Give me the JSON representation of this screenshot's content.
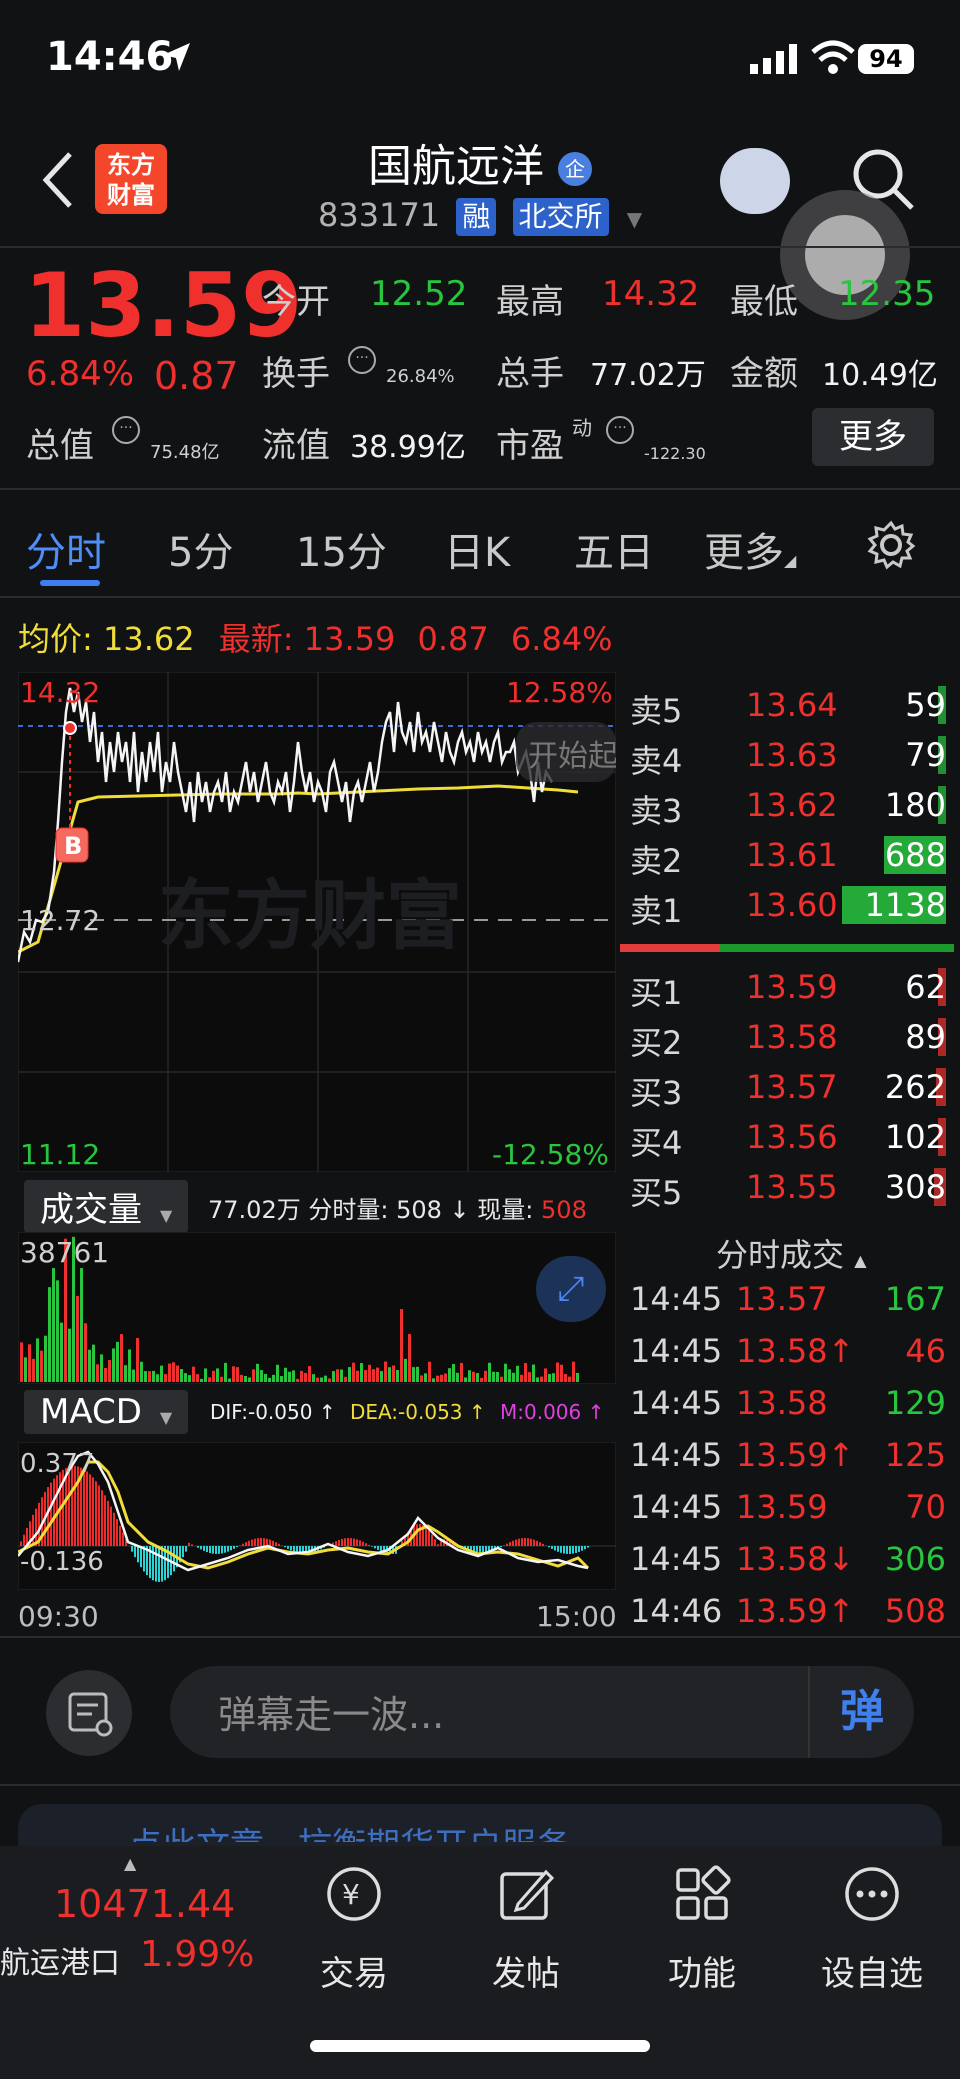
{
  "status_bar": {
    "time": "14:46",
    "battery": "94"
  },
  "header": {
    "title": "国航远洋",
    "code": "833171",
    "tag_rong": "融",
    "tag_exchange": "北交所",
    "logo_line1": "东方",
    "logo_line2": "财富"
  },
  "quote": {
    "price": "13.59",
    "change_pct": "6.84%",
    "change": "0.87",
    "open_label": "今开",
    "open": "12.52",
    "high_label": "最高",
    "high": "14.32",
    "low_label": "最低",
    "low": "12.35",
    "turnover_label": "换手",
    "turnover": "26.84%",
    "volume_label": "总手",
    "volume": "77.02万",
    "amount_label": "金额",
    "amount": "10.49亿",
    "mktcap_label": "总值",
    "mktcap": "75.48亿",
    "float_label": "流值",
    "float_cap": "38.99亿",
    "pe_label": "市盈",
    "pe_sup": "动",
    "pe": "-122.30",
    "more": "更多"
  },
  "tabs": [
    "分时",
    "5分",
    "15分",
    "日K",
    "五日",
    "更多"
  ],
  "info_line": {
    "avg_label": "均价:",
    "avg": "13.62",
    "latest_label": "最新:",
    "latest": "13.59",
    "latest_change": "0.87",
    "latest_pct": "6.84%"
  },
  "chart_labels": {
    "price_high": "14.32",
    "pct_high": "12.58%",
    "price_mid": "12.72",
    "price_low": "11.12",
    "pct_low": "-12.58%",
    "start_hint": "开始起",
    "watermark": "东方财富",
    "buy_marker": "B",
    "time_start": "09:30",
    "time_end": "15:00"
  },
  "volume_panel": {
    "selector": "成交量",
    "total": "77.02万",
    "minute_label": "分时量:",
    "minute": "508",
    "now_label": "现量:",
    "now": "508",
    "max_label": "38761"
  },
  "macd_panel": {
    "selector": "MACD",
    "dif": "DIF:-0.050 ↑",
    "dea": "DEA:-0.053 ↑",
    "m": "M:0.006 ↑",
    "top_label": "0.377",
    "bottom_label": "-0.136"
  },
  "order_book": {
    "sell": [
      {
        "label": "卖5",
        "price": "13.64",
        "vol": "59",
        "bar": 0.02,
        "color": "#28c63f"
      },
      {
        "label": "卖4",
        "price": "13.63",
        "vol": "79",
        "bar": 0.03,
        "color": "#28c63f"
      },
      {
        "label": "卖3",
        "price": "13.62",
        "vol": "180",
        "bar": 0.06,
        "color": "#28c63f"
      },
      {
        "label": "卖2",
        "price": "13.61",
        "vol": "688",
        "bar": 0.6,
        "color": "#28c63f"
      },
      {
        "label": "卖1",
        "price": "13.60",
        "vol": "1138",
        "bar": 1.0,
        "color": "#28c63f"
      }
    ],
    "buy": [
      {
        "label": "买1",
        "price": "13.59",
        "vol": "62",
        "bar": 0.02,
        "color": "#f0302c"
      },
      {
        "label": "买2",
        "price": "13.58",
        "vol": "89",
        "bar": 0.03,
        "color": "#f0302c"
      },
      {
        "label": "买3",
        "price": "13.57",
        "vol": "262",
        "bar": 0.1,
        "color": "#f0302c"
      },
      {
        "label": "买4",
        "price": "13.56",
        "vol": "102",
        "bar": 0.04,
        "color": "#f0302c"
      },
      {
        "label": "买5",
        "price": "13.55",
        "vol": "308",
        "bar": 0.12,
        "color": "#f0302c"
      }
    ],
    "ratio_red": 0.3
  },
  "trades": {
    "header": "分时成交",
    "rows": [
      {
        "time": "14:45",
        "price": "13.57",
        "arrow": "",
        "vol": "167",
        "vol_color": "#28c63f"
      },
      {
        "time": "14:45",
        "price": "13.58↑",
        "arrow": "",
        "vol": "46",
        "vol_color": "#f0302c"
      },
      {
        "time": "14:45",
        "price": "13.58",
        "arrow": "",
        "vol": "129",
        "vol_color": "#28c63f"
      },
      {
        "time": "14:45",
        "price": "13.59↑",
        "arrow": "",
        "vol": "125",
        "vol_color": "#f0302c"
      },
      {
        "time": "14:45",
        "price": "13.59",
        "arrow": "",
        "vol": "70",
        "vol_color": "#f0302c"
      },
      {
        "time": "14:45",
        "price": "13.58↓",
        "arrow": "",
        "vol": "306",
        "vol_color": "#28c63f"
      },
      {
        "time": "14:46",
        "price": "13.59↑",
        "arrow": "",
        "vol": "508",
        "vol_color": "#f0302c"
      }
    ]
  },
  "danmaku": {
    "placeholder": "弹幕走一波...",
    "button": "弹"
  },
  "banner": {
    "text": "点此文章，抗衡期货开户服务"
  },
  "bottom_nav": {
    "index_value": "10471.44",
    "index_name": "航运港口",
    "index_pct": "1.99%",
    "items": [
      "交易",
      "发帖",
      "功能",
      "设自选"
    ]
  },
  "colors": {
    "up": "#f0302c",
    "down": "#28c63f",
    "accent": "#3d7ef2",
    "avg_line": "#f1dd3a"
  }
}
